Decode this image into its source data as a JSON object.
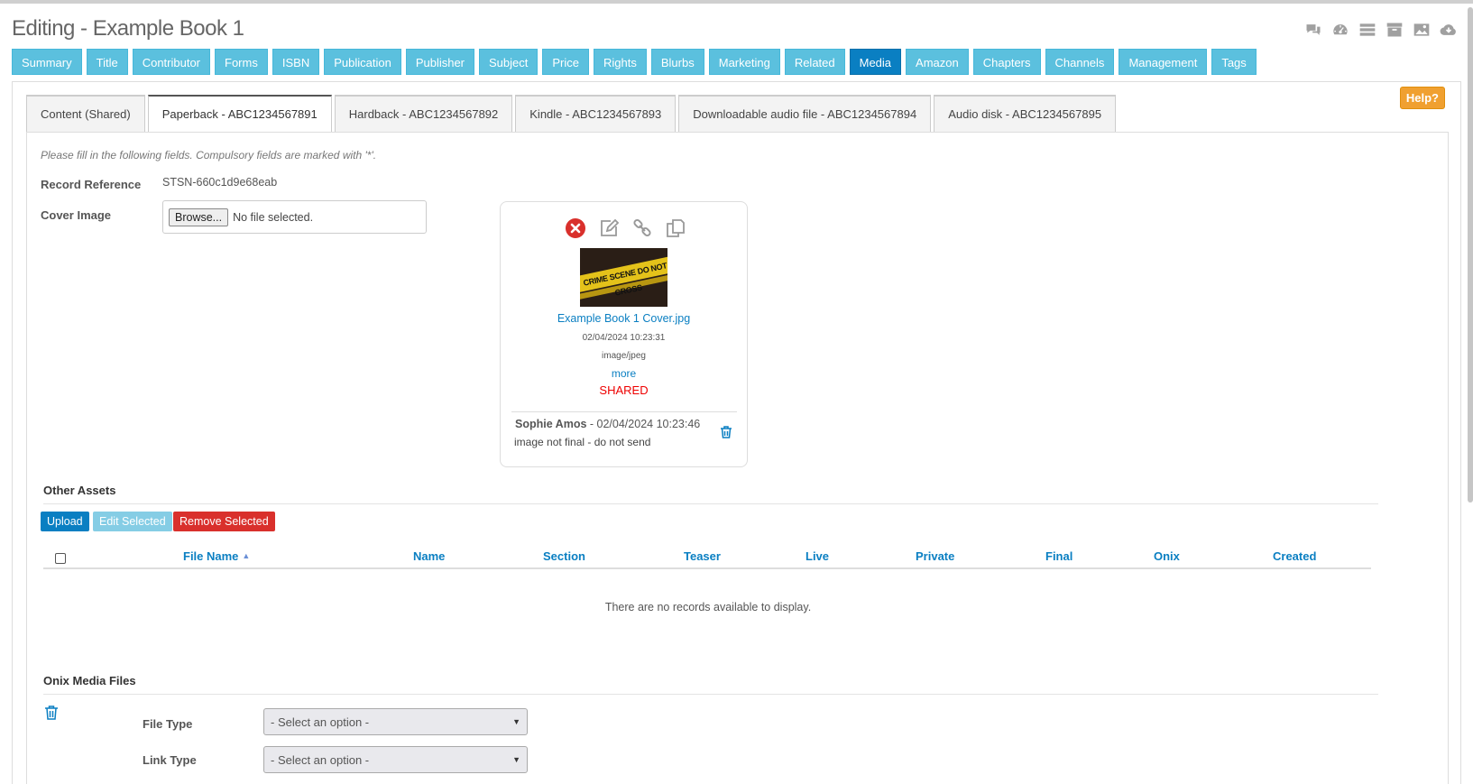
{
  "page": {
    "title": "Editing - Example Book 1",
    "top_icons": [
      "comments-icon",
      "dashboard-icon",
      "list-icon",
      "archive-icon",
      "image-icon",
      "cloud-download-icon"
    ]
  },
  "navbar": {
    "items": [
      "Summary",
      "Title",
      "Contributor",
      "Forms",
      "ISBN",
      "Publication",
      "Publisher",
      "Subject",
      "Price",
      "Rights",
      "Blurbs",
      "Marketing",
      "Related",
      "Media",
      "Amazon",
      "Chapters",
      "Channels",
      "Management",
      "Tags"
    ],
    "active": "Media"
  },
  "help_label": "Help?",
  "tabs": {
    "items": [
      "Content (Shared)",
      "Paperback - ABC1234567891",
      "Hardback - ABC1234567892",
      "Kindle - ABC1234567893",
      "Downloadable audio file - ABC1234567894",
      "Audio disk - ABC1234567895"
    ],
    "active": "Paperback - ABC1234567891"
  },
  "form": {
    "note": "Please fill in the following fields. Compulsory fields are marked with '*'.",
    "record_reference_label": "Record Reference",
    "record_reference_value": "STSN-660c1d9e68eab",
    "cover_image_label": "Cover Image",
    "browse_label": "Browse...",
    "file_status": "No file selected."
  },
  "cover_card": {
    "image_text": "CRIME SCENE DO NOT CROSS",
    "file_name": "Example Book 1 Cover.jpg",
    "date": "02/04/2024 10:23:31",
    "mime": "image/jpeg",
    "more": "more",
    "shared": "SHARED",
    "comment_author": "Sophie Amos",
    "comment_date": " - 02/04/2024 10:23:46",
    "comment_text": "image not final - do not send",
    "colors": {
      "delete": "#d9302c",
      "link": "#0a7fc2",
      "shared": "#ee0000"
    }
  },
  "other_assets": {
    "heading": "Other Assets",
    "upload": "Upload",
    "edit_selected": "Edit Selected",
    "remove_selected": "Remove Selected",
    "columns": [
      "File Name",
      "Name",
      "Section",
      "Teaser",
      "Live",
      "Private",
      "Final",
      "Onix",
      "Created"
    ],
    "sort_indicator": "▲",
    "empty_message": "There are no records available to display."
  },
  "onix": {
    "heading": "Onix Media Files",
    "file_type_label": "File Type",
    "file_type_value": "- Select an option -",
    "link_type_label": "Link Type",
    "link_type_value": "- Select an option -"
  },
  "colors": {
    "nav": "#5bc0de",
    "nav_active": "#0a7fc2",
    "help": "#f0a030",
    "header_text": "#0a7fc2"
  }
}
